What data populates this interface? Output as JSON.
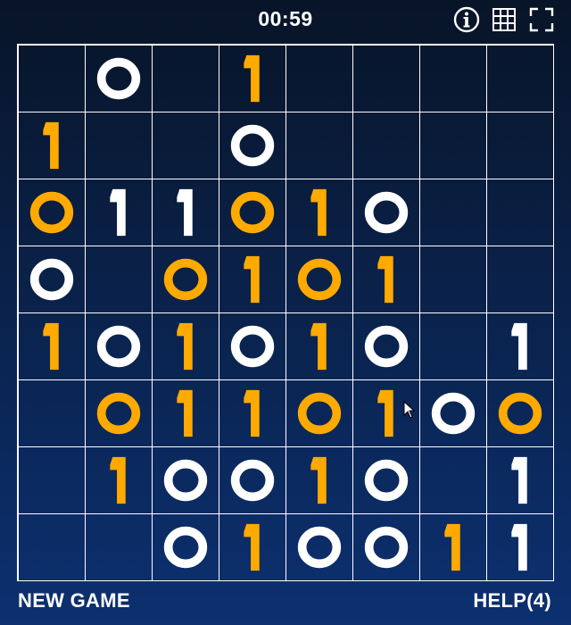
{
  "header": {
    "timer": "00:59",
    "icons": [
      "info-icon",
      "grid-icon",
      "fullscreen-icon"
    ]
  },
  "board": {
    "rows": 8,
    "cols": 8,
    "cells": [
      [
        null,
        "0w",
        null,
        "1o",
        null,
        null,
        null,
        null
      ],
      [
        "1o",
        null,
        null,
        "0w",
        null,
        null,
        null,
        null
      ],
      [
        "0o",
        "1w",
        "1w",
        "0o",
        "1o",
        "0w",
        null,
        null
      ],
      [
        "0w",
        null,
        "0o",
        "1o",
        "0o",
        "1o",
        null,
        null
      ],
      [
        "1o",
        "0w",
        "1o",
        "0w",
        "1o",
        "0w",
        null,
        "1w"
      ],
      [
        null,
        "0o",
        "1o",
        "1o",
        "0o",
        "1o",
        "0w",
        "0o"
      ],
      [
        null,
        "1o",
        "0w",
        "0w",
        "1o",
        "0w",
        null,
        "1w"
      ],
      [
        null,
        null,
        "0w",
        "1o",
        "0w",
        "0w",
        "1o",
        "1w"
      ]
    ],
    "colors": {
      "orange": "#FFAA00",
      "white": "#FFFFFF",
      "grid_line": "#FFFFFF"
    }
  },
  "footer": {
    "new_game_label": "NEW GAME",
    "help_label": "HELP(4)"
  }
}
